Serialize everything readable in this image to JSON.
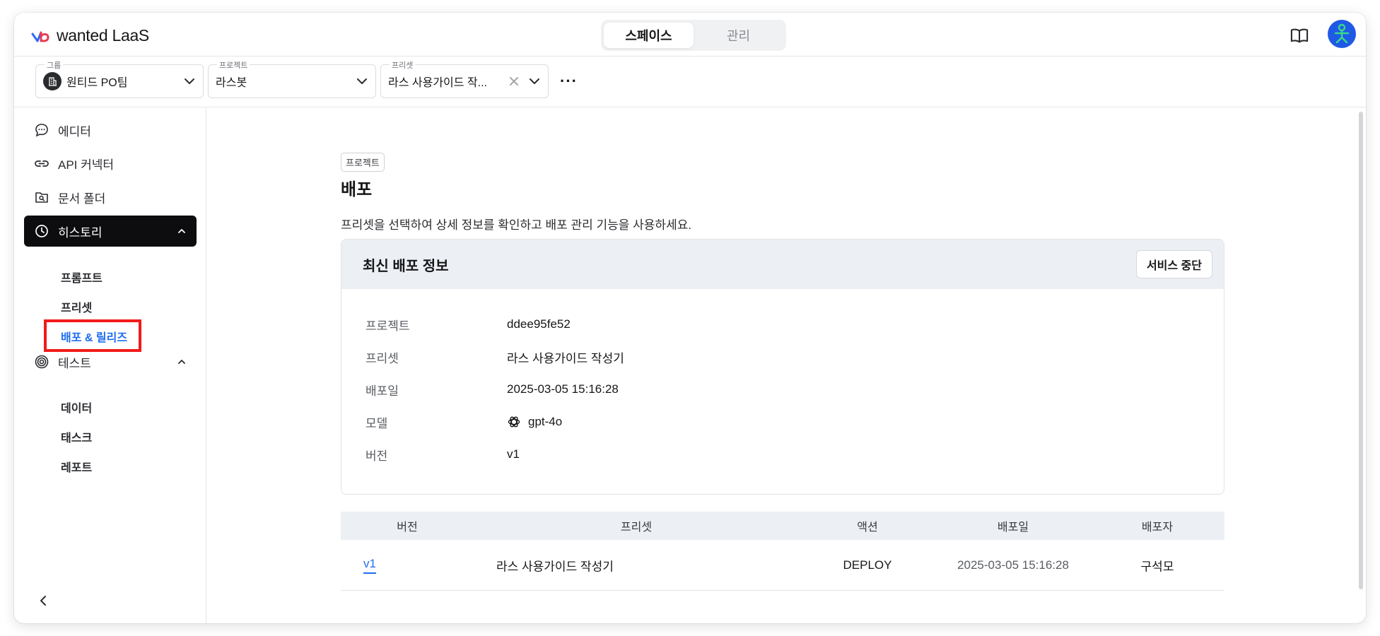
{
  "app": {
    "brand": "wanted LaaS",
    "accent": "#1f6ef0",
    "active_bg": "#0d0d0f",
    "highlight_border": "#f21a1a"
  },
  "top_tabs": [
    {
      "label": "스페이스",
      "active": true
    },
    {
      "label": "관리",
      "active": false
    }
  ],
  "selectors": {
    "group": {
      "label": "그룹",
      "value": "원티드 PO팀"
    },
    "project": {
      "label": "프로젝트",
      "value": "라스봇"
    },
    "preset": {
      "label": "프리셋",
      "value": "라스 사용가이드 작..."
    },
    "more": "···"
  },
  "sidebar": {
    "items": [
      {
        "label": "에디터",
        "icon": "chat-bubble-icon"
      },
      {
        "label": "API 커넥터",
        "icon": "link-icon"
      },
      {
        "label": "문서 폴더",
        "icon": "folder-search-icon"
      },
      {
        "label": "히스토리",
        "icon": "clock-icon",
        "active": true,
        "expanded": true
      },
      {
        "label": "테스트",
        "icon": "target-icon",
        "expanded": true
      }
    ],
    "history_sub": [
      "프롬프트",
      "프리셋",
      "배포 & 릴리즈"
    ],
    "test_sub": [
      "데이터",
      "태스크",
      "레포트"
    ],
    "selected_sub": "배포 & 릴리즈"
  },
  "main": {
    "badge": "프로젝트",
    "title": "배포",
    "description": "프리셋을 선택하여 상세 정보를 확인하고 배포 관리 기능을 사용하세요.",
    "card": {
      "title": "최신 배포 정보",
      "action": "서비스 중단",
      "rows": [
        {
          "key": "프로젝트",
          "value": "ddee95fe52"
        },
        {
          "key": "프리셋",
          "value": "라스 사용가이드 작성기"
        },
        {
          "key": "배포일",
          "value": "2025-03-05 15:16:28"
        },
        {
          "key": "모델",
          "value": "gpt-4o",
          "icon": "openai-icon"
        },
        {
          "key": "버전",
          "value": "v1"
        }
      ]
    },
    "table": {
      "columns": [
        "버전",
        "프리셋",
        "액션",
        "배포일",
        "배포자"
      ],
      "rows": [
        [
          "v1",
          "라스 사용가이드 작성기",
          "DEPLOY",
          "2025-03-05 15:16:28",
          "구석모"
        ]
      ]
    }
  }
}
